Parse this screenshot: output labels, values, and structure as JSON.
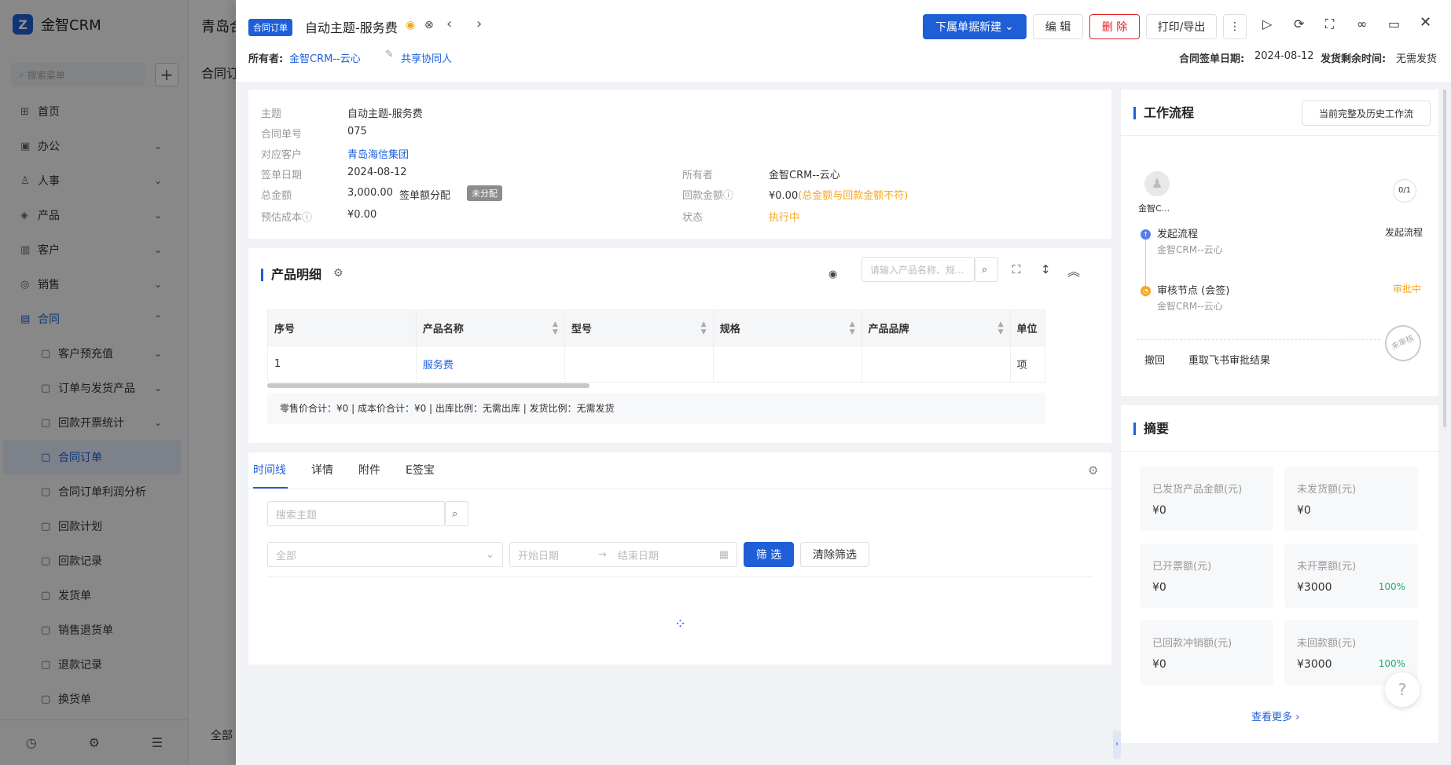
{
  "sidebar": {
    "brand": "金智CRM",
    "search_placeholder": "搜索菜单",
    "items": [
      {
        "label": "首页",
        "icon": "grid-icon"
      },
      {
        "label": "办公",
        "icon": "briefcase-icon"
      },
      {
        "label": "人事",
        "icon": "person-icon"
      },
      {
        "label": "产品",
        "icon": "box-icon"
      },
      {
        "label": "客户",
        "icon": "chart-icon"
      },
      {
        "label": "销售",
        "icon": "sales-icon"
      },
      {
        "label": "合同",
        "icon": "contract-icon"
      }
    ],
    "sub_items": [
      {
        "label": "客户预充值"
      },
      {
        "label": "订单与发货产品"
      },
      {
        "label": "回款开票统计"
      },
      {
        "label": "合同订单"
      },
      {
        "label": "合同订单利润分析"
      },
      {
        "label": "回款计划"
      },
      {
        "label": "回款记录"
      },
      {
        "label": "发货单"
      },
      {
        "label": "销售退货单"
      },
      {
        "label": "退款记录"
      },
      {
        "label": "换货单"
      }
    ]
  },
  "background": {
    "title": "青岛合",
    "subtitle": "合同订",
    "filter": "全部"
  },
  "header": {
    "type_tag": "合同订单",
    "title": "自动主题-服务费",
    "owner_label": "所有者:",
    "owner_value": "金智CRM--云心",
    "share_label": "共享协同人",
    "sign_date_label": "合同签单日期:",
    "sign_date_value": "2024-08-12",
    "remaining_label": "发货剩余时间:",
    "remaining_value": "无需发货",
    "btn_new": "下属单据新建",
    "btn_edit": "编 辑",
    "btn_delete": "删 除",
    "btn_print": "打印/导出"
  },
  "info": {
    "subject_label": "主题",
    "subject": "自动主题-服务费",
    "no_label": "合同单号",
    "no": "075",
    "customer_label": "对应客户",
    "customer": "青岛海信集团",
    "date_label": "签单日期",
    "date": "2024-08-12",
    "owner_label": "所有者",
    "owner": "金智CRM--云心",
    "amount_label": "总金额",
    "amount": "3,000.00",
    "alloc_label": "签单额分配",
    "alloc_tag": "未分配",
    "received_label": "回款金额",
    "received": "¥0.00",
    "received_note": "(总金额与回款金额不符)",
    "cost_label": "预估成本",
    "cost": "¥0.00",
    "status_label": "状态",
    "status": "执行中"
  },
  "products": {
    "title": "产品明细",
    "search_placeholder": "请输入产品名称、规...",
    "columns": [
      "序号",
      "产品名称",
      "型号",
      "规格",
      "产品品牌",
      "单位"
    ],
    "rows": [
      [
        "1",
        "服务费",
        "",
        "",
        "",
        "项"
      ]
    ],
    "footer": "零售价合计：¥0 | 成本价合计：¥0 | 出库比例：无需出库 | 发货比例：无需发货"
  },
  "tabs": {
    "items": [
      "时间线",
      "详情",
      "附件",
      "E签宝"
    ],
    "search_placeholder": "搜索主题",
    "all_placeholder": "全部",
    "start_placeholder": "开始日期",
    "end_placeholder": "结束日期",
    "filter_btn": "筛 选",
    "clear_btn": "清除筛选"
  },
  "workflow": {
    "title": "工作流程",
    "history_btn": "当前完整及历史工作流",
    "user": "金智C...",
    "progress": "0/1",
    "steps": [
      {
        "name": "发起流程",
        "who": "金智CRM--云心",
        "status": "发起流程"
      },
      {
        "name": "审核节点 (会签)",
        "who": "金智CRM--云心",
        "status": "审批中"
      }
    ],
    "revoke": "撤回",
    "refetch": "重取飞书审批结果",
    "stamp": "未审核"
  },
  "summary": {
    "title": "摘要",
    "boxes": [
      {
        "t": "已发货产品金额(元)",
        "v": "¥0",
        "p": ""
      },
      {
        "t": "未发货额(元)",
        "v": "¥0",
        "p": ""
      },
      {
        "t": "已开票额(元)",
        "v": "¥0",
        "p": ""
      },
      {
        "t": "未开票额(元)",
        "v": "¥3000",
        "p": "100%"
      },
      {
        "t": "已回款冲销额(元)",
        "v": "¥0",
        "p": ""
      },
      {
        "t": "未回款额(元)",
        "v": "¥3000",
        "p": "100%"
      }
    ],
    "more": "查看更多"
  }
}
